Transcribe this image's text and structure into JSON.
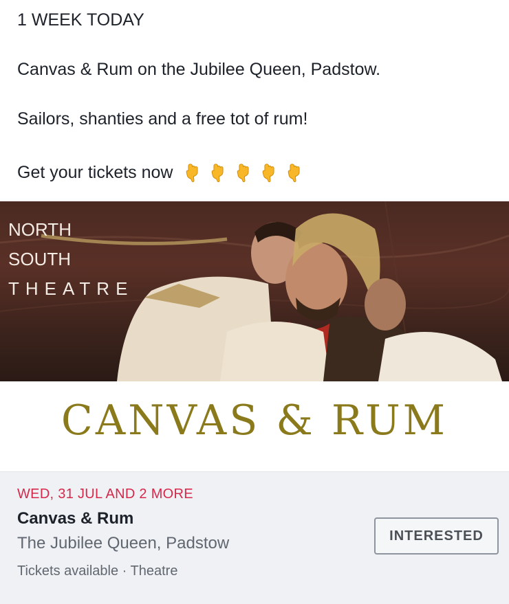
{
  "post": {
    "line1": "1 WEEK TODAY",
    "line2": "Canvas & Rum on the Jubilee Queen, Padstow.",
    "line3": "Sailors, shanties and a free tot of rum!",
    "line4": "Get your tickets now",
    "emoji_icon": "pointing-down-hand-icon",
    "emoji_count": 5
  },
  "banner": {
    "brand_line1": "NORTH",
    "brand_line2": "SOUTH",
    "brand_line3": "THEATRE",
    "title": "CANVAS & RUM",
    "title_color": "#8a7a1c"
  },
  "event": {
    "date": "WED, 31 JUL AND 2 MORE",
    "name": "Canvas & Rum",
    "venue": "The Jubilee Queen, Padstow",
    "meta": "Tickets available · Theatre",
    "button_label": "INTERESTED",
    "date_color": "#d5284a"
  }
}
